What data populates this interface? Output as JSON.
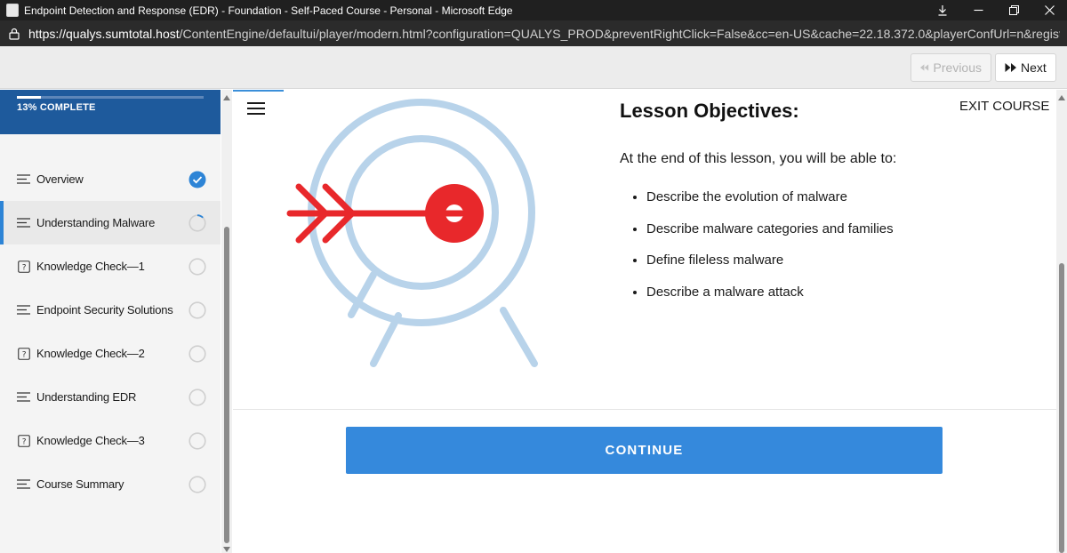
{
  "window": {
    "title": "Endpoint Detection and Response (EDR) - Foundation - Self-Paced Course - Personal - Microsoft Edge",
    "controls": [
      "download-icon",
      "minimize-icon",
      "restore-icon",
      "close-icon"
    ]
  },
  "address_bar": {
    "url_host": "https://qualys.sumtotal.host",
    "url_path": "/ContentEngine/defaultui/player/modern.html?configuration=QUALYS_PROD&preventRightClick=False&cc=en-US&cache=22.18.372.0&playerConfUrl=n&registration=..."
  },
  "nav": {
    "previous_label": "Previous",
    "next_label": "Next"
  },
  "sidebar": {
    "progress_label": "13% COMPLETE",
    "progress_fraction": 0.13,
    "items": [
      {
        "label": "Overview",
        "type": "lesson",
        "status": "complete"
      },
      {
        "label": "Understanding Malware",
        "type": "lesson",
        "status": "in-progress"
      },
      {
        "label": "Knowledge Check—1",
        "type": "quiz",
        "status": "not-started"
      },
      {
        "label": "Endpoint Security Solutions",
        "type": "lesson",
        "status": "not-started"
      },
      {
        "label": "Knowledge Check—2",
        "type": "quiz",
        "status": "not-started"
      },
      {
        "label": "Understanding EDR",
        "type": "lesson",
        "status": "not-started"
      },
      {
        "label": "Knowledge Check—3",
        "type": "quiz",
        "status": "not-started"
      },
      {
        "label": "Course Summary",
        "type": "lesson",
        "status": "not-started"
      }
    ]
  },
  "main": {
    "exit_label": "EXIT COURSE",
    "heading": "Lesson Objectives:",
    "intro": "At the end of this lesson, you will be able to:",
    "objectives": [
      "Describe the evolution of malware",
      "Describe malware categories and families",
      "Define fileless malware",
      "Describe a malware attack"
    ],
    "continue_label": "CONTINUE"
  },
  "colors": {
    "accent_blue": "#3589dc",
    "sidebar_header": "#1e5a9c",
    "target_ring": "#b8d3ea",
    "arrow_red": "#e8282b"
  }
}
